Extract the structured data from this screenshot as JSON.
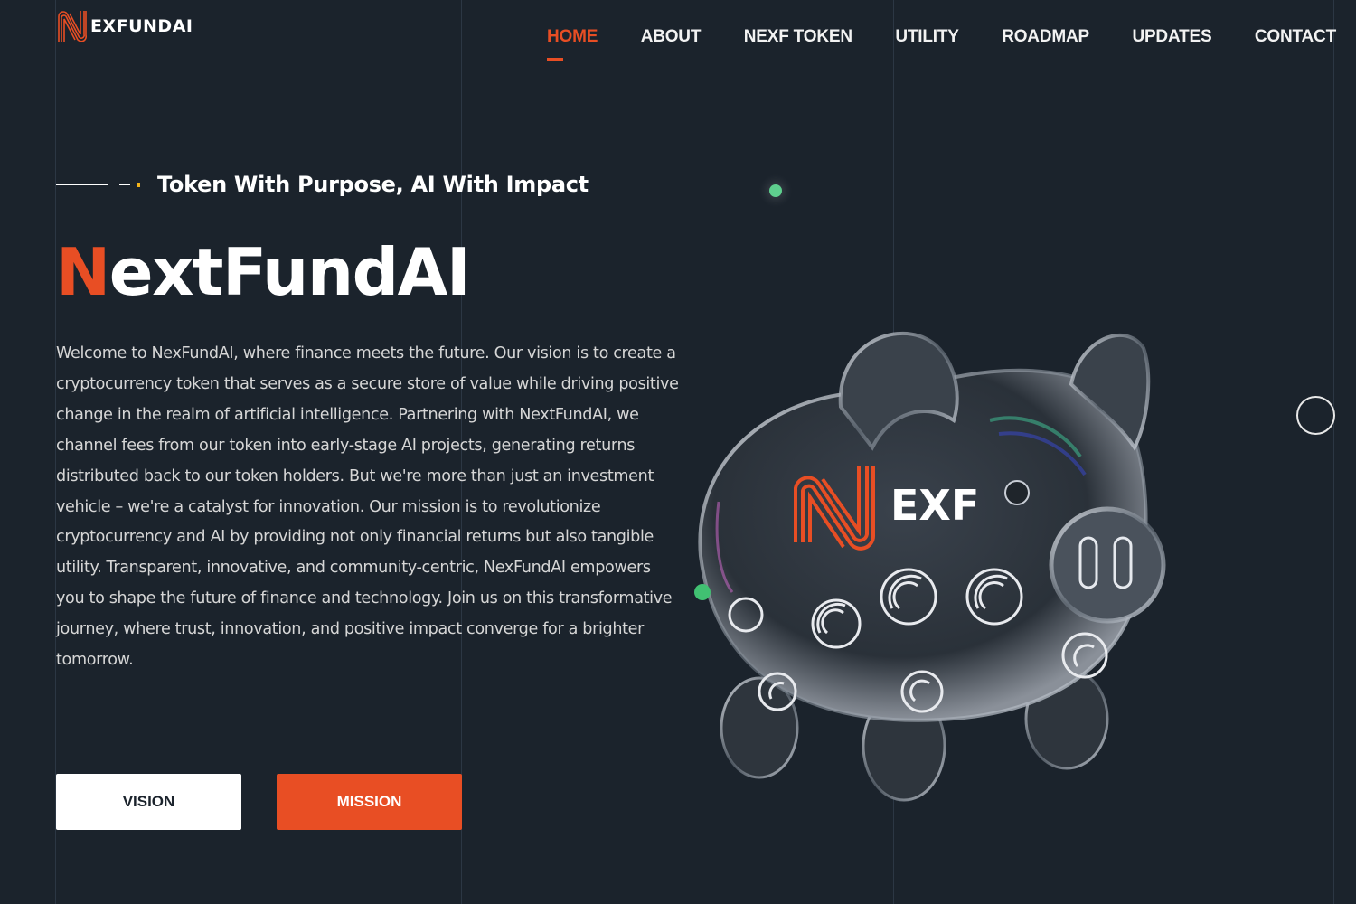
{
  "brand": {
    "logo_text": "EXFUNDAI",
    "logo_letter": "N",
    "accent_color": "#e84e24",
    "background_color": "#1b232c"
  },
  "nav": {
    "items": [
      {
        "label": "HOME",
        "active": true
      },
      {
        "label": "ABOUT",
        "active": false
      },
      {
        "label": "NEXF TOKEN",
        "active": false
      },
      {
        "label": "UTILITY",
        "active": false
      },
      {
        "label": "ROADMAP",
        "active": false
      },
      {
        "label": "UPDATES",
        "active": false
      },
      {
        "label": "CONTACT",
        "active": false
      }
    ]
  },
  "hero": {
    "tagline": "Token With Purpose, AI With Impact",
    "title_accent": "N",
    "title_rest": "extFundAI",
    "description": "Welcome to NexFundAI, where finance meets the future. Our vision is to create a cryptocurrency token that serves as a secure store of value while driving positive change in the realm of artificial intelligence. Partnering with NextFundAI, we channel fees from our token into early-stage AI projects, generating returns distributed back to our token holders. But we're more than just an investment vehicle – we're a catalyst for innovation. Our mission is to revolutionize cryptocurrency and AI by providing not only financial returns but also tangible utility. Transparent, innovative, and community-centric, NexFundAI empowers you to shape the future of finance and technology. Join us on this transformative journey, where trust, innovation, and positive impact converge for a brighter tomorrow.",
    "buttons": {
      "vision": "VISION",
      "mission": "MISSION"
    },
    "image": {
      "alt": "Glass piggy bank with NEXF logo",
      "logo_text": "EXF"
    }
  },
  "icons": {
    "logo": "nexfundai-n-logo-icon",
    "decor_dot": "green-dot-icon",
    "cursor_ring": "circle-cursor-icon"
  }
}
